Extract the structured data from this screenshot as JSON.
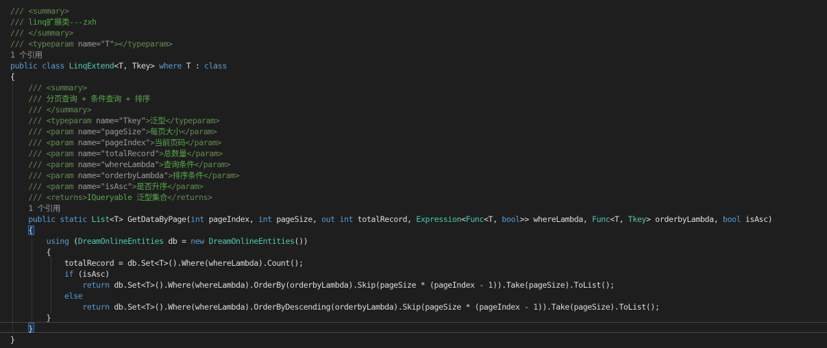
{
  "colors": {
    "background": "#1e1e1e",
    "keyword": "#569cd6",
    "type": "#4ec9b0",
    "comment_text": "#57a64a",
    "comment_tag": "#608b4e",
    "doc_delimiter": "#999999",
    "number": "#b8d7a3",
    "plain": "#dcdcdc"
  },
  "lines": [
    [
      {
        "s": "x",
        "t": "/// <summary>"
      }
    ],
    [
      {
        "s": "x",
        "t": "/// "
      },
      {
        "s": "c",
        "t": "linq扩展类---zxh"
      }
    ],
    [
      {
        "s": "x",
        "t": "/// </summary>"
      }
    ],
    [
      {
        "s": "x",
        "t": "/// <typeparam "
      },
      {
        "s": "g",
        "t": "name=\"T\""
      },
      {
        "s": "x",
        "t": "></typeparam>"
      }
    ],
    [
      {
        "s": "g",
        "t": "1 个引用"
      }
    ],
    [
      {
        "s": "k",
        "t": "public"
      },
      {
        "s": "p",
        "t": " "
      },
      {
        "s": "k",
        "t": "class"
      },
      {
        "s": "p",
        "t": " "
      },
      {
        "s": "t",
        "t": "LinqExtend"
      },
      {
        "s": "p",
        "t": "<T, Tkey> "
      },
      {
        "s": "k",
        "t": "where"
      },
      {
        "s": "p",
        "t": " T : "
      },
      {
        "s": "k",
        "t": "class"
      }
    ],
    [
      {
        "s": "p",
        "t": "{"
      }
    ],
    [
      {
        "s": "p",
        "t": "    "
      },
      {
        "s": "x",
        "t": "/// <summary>"
      }
    ],
    [
      {
        "s": "p",
        "t": "    "
      },
      {
        "s": "x",
        "t": "/// "
      },
      {
        "s": "c",
        "t": "分页查询 + 条件查询 + 排序"
      }
    ],
    [
      {
        "s": "p",
        "t": "    "
      },
      {
        "s": "x",
        "t": "/// </summary>"
      }
    ],
    [
      {
        "s": "p",
        "t": "    "
      },
      {
        "s": "x",
        "t": "/// <typeparam "
      },
      {
        "s": "g",
        "t": "name=\"Tkey\""
      },
      {
        "s": "x",
        "t": ">"
      },
      {
        "s": "c",
        "t": "泛型"
      },
      {
        "s": "x",
        "t": "</typeparam>"
      }
    ],
    [
      {
        "s": "p",
        "t": "    "
      },
      {
        "s": "x",
        "t": "/// <param "
      },
      {
        "s": "g",
        "t": "name=\"pageSize\""
      },
      {
        "s": "x",
        "t": ">"
      },
      {
        "s": "c",
        "t": "每页大小"
      },
      {
        "s": "x",
        "t": "</param>"
      }
    ],
    [
      {
        "s": "p",
        "t": "    "
      },
      {
        "s": "x",
        "t": "/// <param "
      },
      {
        "s": "g",
        "t": "name=\"pageIndex\""
      },
      {
        "s": "x",
        "t": ">"
      },
      {
        "s": "c",
        "t": "当前页码"
      },
      {
        "s": "x",
        "t": "</param>"
      }
    ],
    [
      {
        "s": "p",
        "t": "    "
      },
      {
        "s": "x",
        "t": "/// <param "
      },
      {
        "s": "g",
        "t": "name=\"totalRecord\""
      },
      {
        "s": "x",
        "t": ">"
      },
      {
        "s": "c",
        "t": "总数量"
      },
      {
        "s": "x",
        "t": "</param>"
      }
    ],
    [
      {
        "s": "p",
        "t": "    "
      },
      {
        "s": "x",
        "t": "/// <param "
      },
      {
        "s": "g",
        "t": "name=\"whereLambda\""
      },
      {
        "s": "x",
        "t": ">"
      },
      {
        "s": "c",
        "t": "查询条件"
      },
      {
        "s": "x",
        "t": "</param>"
      }
    ],
    [
      {
        "s": "p",
        "t": "    "
      },
      {
        "s": "x",
        "t": "/// <param "
      },
      {
        "s": "g",
        "t": "name=\"orderbyLambda\""
      },
      {
        "s": "x",
        "t": ">"
      },
      {
        "s": "c",
        "t": "排序条件"
      },
      {
        "s": "x",
        "t": "</param>"
      }
    ],
    [
      {
        "s": "p",
        "t": "    "
      },
      {
        "s": "x",
        "t": "/// <param "
      },
      {
        "s": "g",
        "t": "name=\"isAsc\""
      },
      {
        "s": "x",
        "t": ">"
      },
      {
        "s": "c",
        "t": "是否升序"
      },
      {
        "s": "x",
        "t": "</param>"
      }
    ],
    [
      {
        "s": "p",
        "t": "    "
      },
      {
        "s": "x",
        "t": "/// <returns>"
      },
      {
        "s": "c",
        "t": "IQueryable 泛型集合"
      },
      {
        "s": "x",
        "t": "</returns>"
      }
    ],
    [
      {
        "s": "p",
        "t": "    "
      },
      {
        "s": "g",
        "t": "1 个引用"
      }
    ],
    [
      {
        "s": "p",
        "t": "    "
      },
      {
        "s": "k",
        "t": "public"
      },
      {
        "s": "p",
        "t": " "
      },
      {
        "s": "k",
        "t": "static"
      },
      {
        "s": "p",
        "t": " "
      },
      {
        "s": "t",
        "t": "List"
      },
      {
        "s": "p",
        "t": "<T> GetDataByPage("
      },
      {
        "s": "k",
        "t": "int"
      },
      {
        "s": "p",
        "t": " pageIndex, "
      },
      {
        "s": "k",
        "t": "int"
      },
      {
        "s": "p",
        "t": " pageSize, "
      },
      {
        "s": "k",
        "t": "out"
      },
      {
        "s": "p",
        "t": " "
      },
      {
        "s": "k",
        "t": "int"
      },
      {
        "s": "p",
        "t": " totalRecord, "
      },
      {
        "s": "t",
        "t": "Expression"
      },
      {
        "s": "p",
        "t": "<"
      },
      {
        "s": "t",
        "t": "Func"
      },
      {
        "s": "p",
        "t": "<T, "
      },
      {
        "s": "k",
        "t": "bool"
      },
      {
        "s": "p",
        "t": ">> whereLambda, "
      },
      {
        "s": "t",
        "t": "Func"
      },
      {
        "s": "p",
        "t": "<T, "
      },
      {
        "s": "t",
        "t": "Tkey"
      },
      {
        "s": "p",
        "t": "> orderbyLambda, "
      },
      {
        "s": "k",
        "t": "bool"
      },
      {
        "s": "p",
        "t": " isAsc)"
      }
    ],
    [
      {
        "s": "p",
        "t": "    {"
      }
    ],
    [
      {
        "s": "p",
        "t": "        "
      },
      {
        "s": "k",
        "t": "using"
      },
      {
        "s": "p",
        "t": " ("
      },
      {
        "s": "t",
        "t": "DreamOnlineEntities"
      },
      {
        "s": "p",
        "t": " db = "
      },
      {
        "s": "k",
        "t": "new"
      },
      {
        "s": "p",
        "t": " "
      },
      {
        "s": "t",
        "t": "DreamOnlineEntities"
      },
      {
        "s": "p",
        "t": "())"
      }
    ],
    [
      {
        "s": "p",
        "t": "        {"
      }
    ],
    [
      {
        "s": "p",
        "t": "            totalRecord = db.Set<T>().Where(whereLambda).Count();"
      }
    ],
    [
      {
        "s": "p",
        "t": "            "
      },
      {
        "s": "k",
        "t": "if"
      },
      {
        "s": "p",
        "t": " (isAsc)"
      }
    ],
    [
      {
        "s": "p",
        "t": "                "
      },
      {
        "s": "k",
        "t": "return"
      },
      {
        "s": "p",
        "t": " db.Set<T>().Where(whereLambda).OrderBy(orderbyLambda).Skip(pageSize * (pageIndex - "
      },
      {
        "s": "n",
        "t": "1"
      },
      {
        "s": "p",
        "t": ")).Take(pageSize).ToList();"
      }
    ],
    [
      {
        "s": "p",
        "t": "            "
      },
      {
        "s": "k",
        "t": "else"
      }
    ],
    [
      {
        "s": "p",
        "t": "                "
      },
      {
        "s": "k",
        "t": "return"
      },
      {
        "s": "p",
        "t": " db.Set<T>().Where(whereLambda).OrderByDescending(orderbyLambda).Skip(pageSize * (pageIndex - "
      },
      {
        "s": "n",
        "t": "1"
      },
      {
        "s": "p",
        "t": ")).Take(pageSize).ToList();"
      }
    ],
    [
      {
        "s": "p",
        "t": "        }"
      }
    ],
    [
      {
        "s": "p",
        "t": "    }"
      }
    ],
    [
      {
        "s": "p",
        "t": "}"
      }
    ]
  ]
}
